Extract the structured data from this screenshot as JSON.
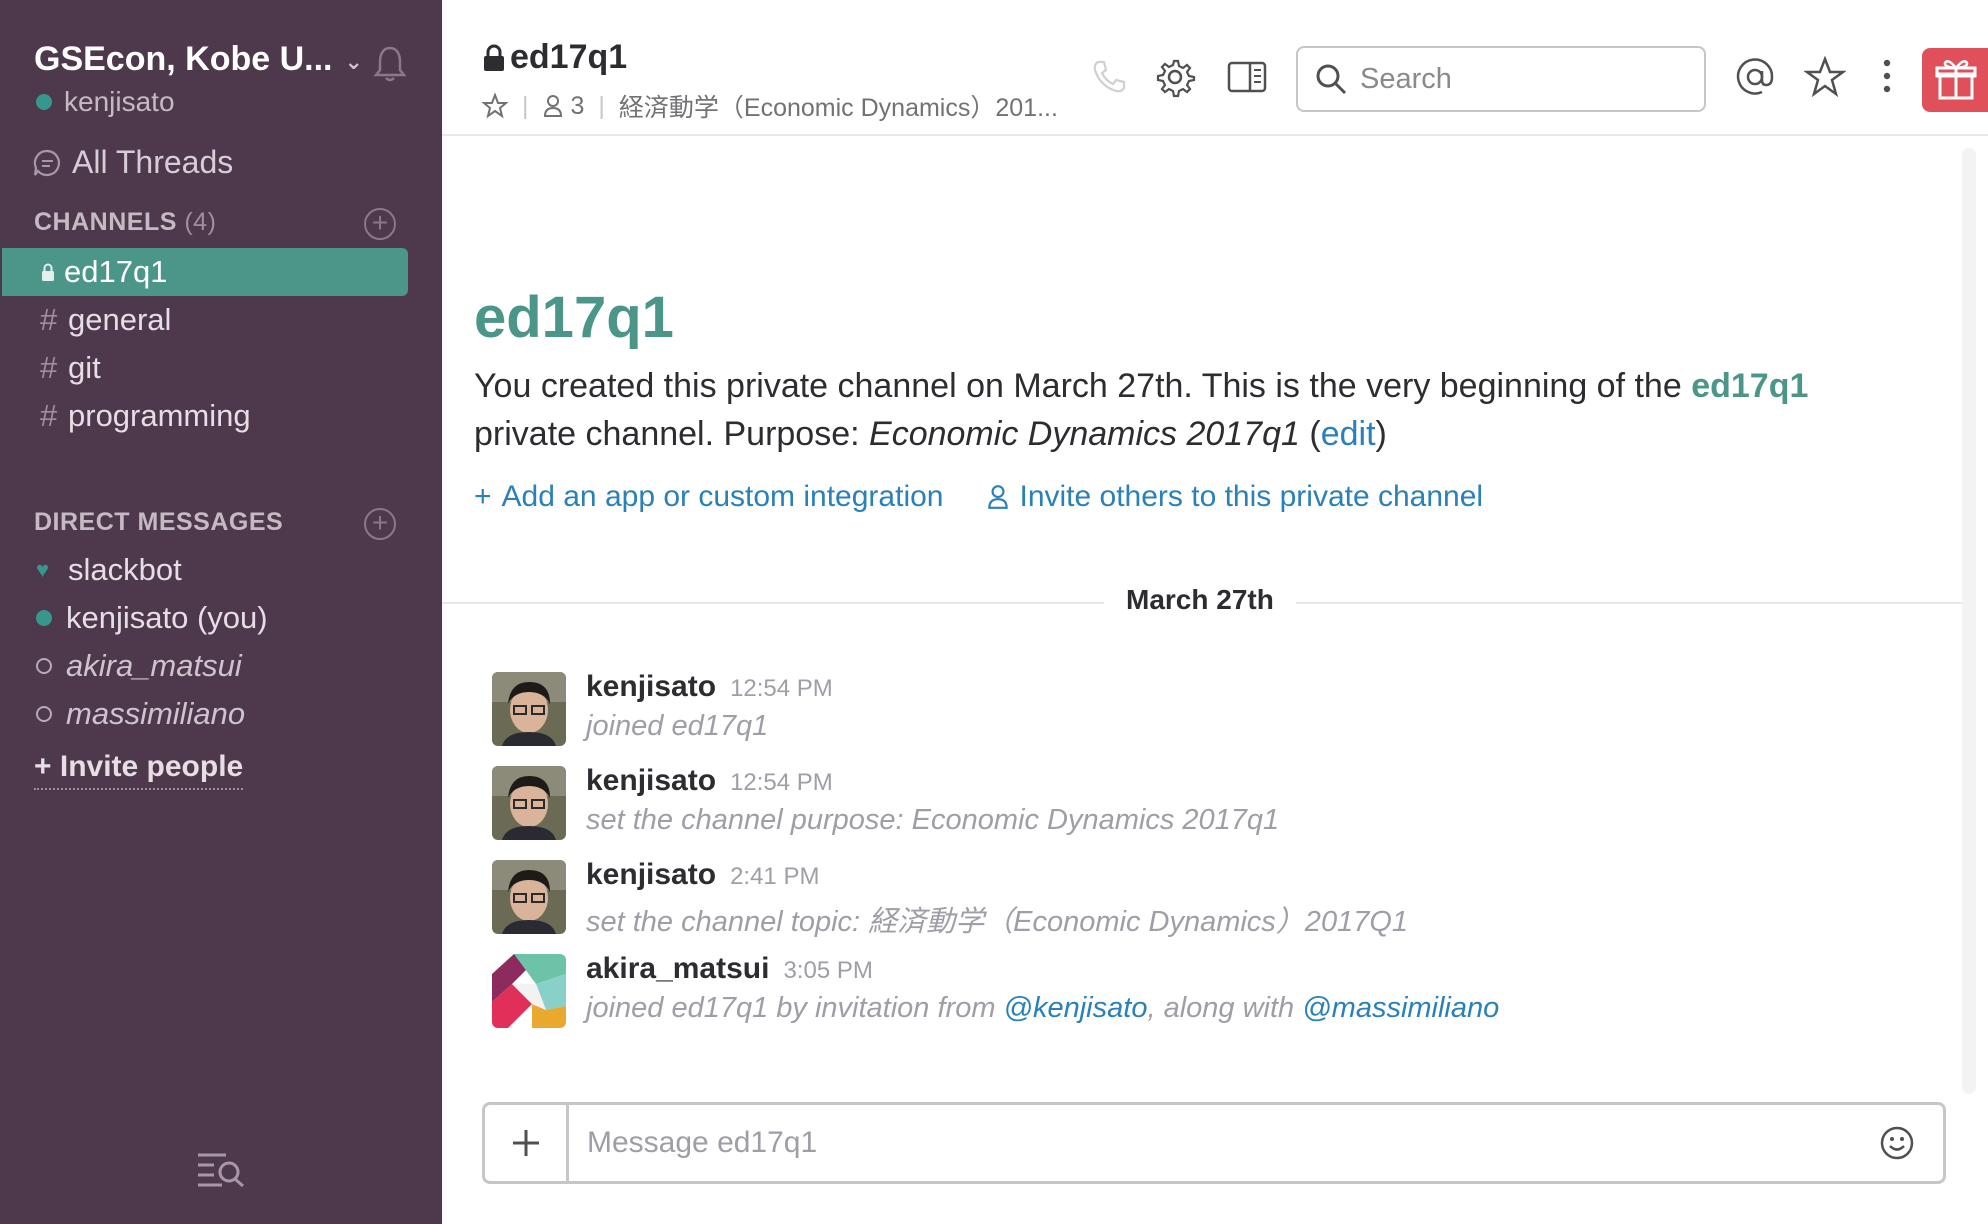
{
  "sidebar": {
    "team_name": "GSEcon, Kobe U...",
    "user": "kenjisato",
    "all_threads": "All Threads",
    "channels_header": "CHANNELS",
    "channels_count": "(4)",
    "channels": [
      {
        "name": "ed17q1",
        "private": true,
        "active": true
      },
      {
        "name": "general",
        "private": false,
        "active": false
      },
      {
        "name": "git",
        "private": false,
        "active": false
      },
      {
        "name": "programming",
        "private": false,
        "active": false
      }
    ],
    "dm_header": "DIRECT MESSAGES",
    "dms": [
      {
        "name": "slackbot",
        "status": "bot"
      },
      {
        "name": "kenjisato (you)",
        "status": "online"
      },
      {
        "name": "akira_matsui",
        "status": "away"
      },
      {
        "name": "massimiliano",
        "status": "away"
      }
    ],
    "invite_label": "Invite people",
    "accent": "#4c9689",
    "background": "#4d394b"
  },
  "header": {
    "channel_name": "ed17q1",
    "member_count": "3",
    "topic": "経済動学（Economic Dynamics）201...",
    "search_placeholder": "Search"
  },
  "intro": {
    "title": "ed17q1",
    "text_1": "You created this private channel on March 27th. This is the very beginning of the ",
    "channel_link": "ed17q1",
    "text_2": " private channel. Purpose: ",
    "purpose": "Economic Dynamics 2017q1",
    "edit_open": " (",
    "edit_label": "edit",
    "edit_close": ")",
    "add_app": "Add an app or custom integration",
    "invite_others": "Invite others to this private channel"
  },
  "date_divider": "March 27th",
  "messages": [
    {
      "user": "kenjisato",
      "time": "12:54 PM",
      "text": "joined ed17q1"
    },
    {
      "user": "kenjisato",
      "time": "12:54 PM",
      "text": "set the channel purpose: Economic Dynamics 2017q1"
    },
    {
      "user": "kenjisato",
      "time": "2:41 PM",
      "text": "set the channel topic: 経済動学（Economic Dynamics）2017Q1"
    },
    {
      "user": "akira_matsui",
      "time": "3:05 PM",
      "text_1": "joined ed17q1 by invitation from ",
      "mention_1": "@kenjisato",
      "text_2": ", along with ",
      "mention_2": "@massimiliano"
    }
  ],
  "composer": {
    "placeholder": "Message ed17q1"
  },
  "icons": {
    "bell": "bell-icon",
    "threads": "threads-icon",
    "lock": "lock-icon",
    "phone": "phone-icon",
    "gear": "gear-icon",
    "details": "details-panel-icon",
    "search": "search-icon",
    "mention": "at-sign-icon",
    "star": "star-icon",
    "more": "more-vertical-icon",
    "gift": "gift-icon",
    "emoji": "emoji-icon"
  }
}
